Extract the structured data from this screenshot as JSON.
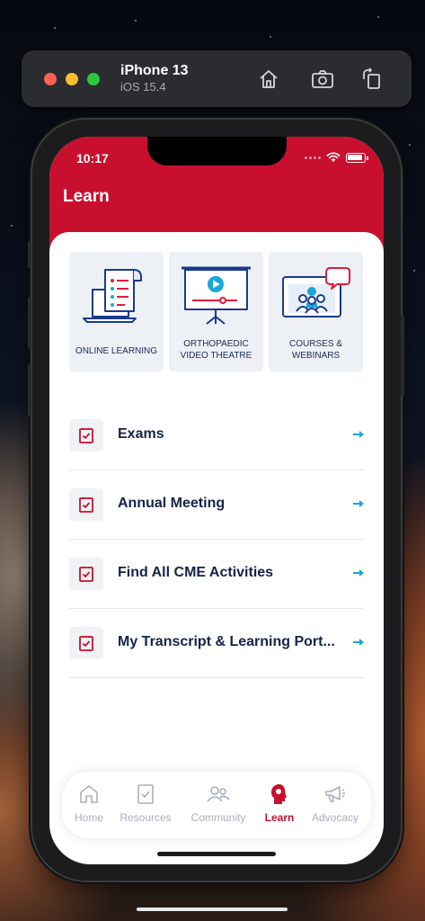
{
  "simulator": {
    "device": "iPhone 13",
    "os": "iOS 15.4"
  },
  "status_bar": {
    "time": "10:17"
  },
  "header": {
    "title": "Learn"
  },
  "tiles": [
    {
      "label": "ONLINE LEARNING",
      "icon": "laptop-checklist-icon"
    },
    {
      "label": "ORTHOPAEDIC VIDEO THEATRE",
      "icon": "video-presentation-icon"
    },
    {
      "label": "COURSES & WEBINARS",
      "icon": "webinar-icon"
    }
  ],
  "menu": [
    {
      "label": "Exams"
    },
    {
      "label": "Annual Meeting"
    },
    {
      "label": "Find All CME Activities"
    },
    {
      "label": "My Transcript & Learning Port..."
    }
  ],
  "tabbar": {
    "items": [
      {
        "label": "Home",
        "icon": "home-icon"
      },
      {
        "label": "Resources",
        "icon": "resources-icon"
      },
      {
        "label": "Community",
        "icon": "community-icon"
      },
      {
        "label": "Learn",
        "icon": "learn-head-icon",
        "active": true
      },
      {
        "label": "Advocacy",
        "icon": "megaphone-icon"
      }
    ]
  },
  "colors": {
    "brand_red": "#c8102e",
    "navy": "#16224a",
    "arrow_teal": "#1aa7d6",
    "tile_bg": "#edf0f5",
    "tab_inactive": "#a9afbd"
  }
}
